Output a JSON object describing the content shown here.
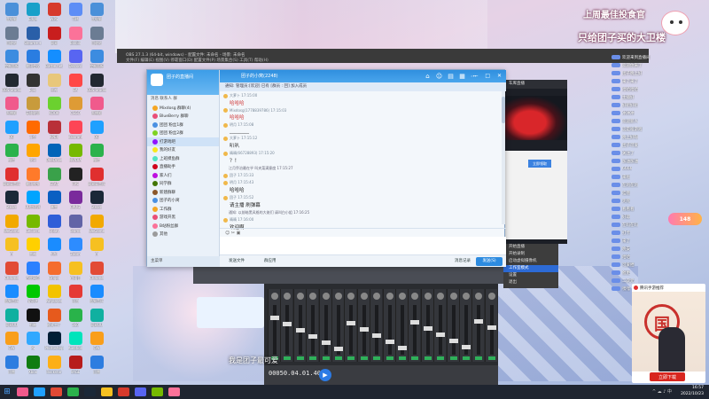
{
  "desktop": {
    "icons_col1": [
      {
        "label": "此电脑",
        "color": "#4a90d9"
      },
      {
        "label": "回收站",
        "color": "#6b7c93"
      },
      {
        "label": "控制面板",
        "color": "#3c8ce0"
      },
      {
        "label": "OBS Studio",
        "color": "#222831"
      },
      {
        "label": "直播姬",
        "color": "#f05a8c"
      },
      {
        "label": "QQ",
        "color": "#1fa0ff"
      },
      {
        "label": "微信",
        "color": "#2bb24c"
      },
      {
        "label": "网易云音乐",
        "color": "#e02f2f"
      },
      {
        "label": "Steam",
        "color": "#1b2838"
      },
      {
        "label": "WeGame",
        "color": "#f2a900"
      },
      {
        "label": "YY",
        "color": "#f6c021"
      },
      {
        "label": "Chrome",
        "color": "#e24a35"
      },
      {
        "label": "酷狗音乐",
        "color": "#1a8cff"
      },
      {
        "label": "网易UU",
        "color": "#10b0a0"
      },
      {
        "label": "OW",
        "color": "#f99e1a"
      },
      {
        "label": "迅雷",
        "color": "#2d7de0"
      }
    ],
    "icons_col2": [
      {
        "label": "Edge",
        "color": "#18a0c9"
      },
      {
        "label": "Steam++",
        "color": "#2a5fa8"
      },
      {
        "label": "腾讯会议",
        "color": "#2a7de1"
      },
      {
        "label": "Epic",
        "color": "#333"
      },
      {
        "label": "英雄联盟",
        "color": "#c89b3c"
      },
      {
        "label": "斗鱼",
        "color": "#ff6a00"
      },
      {
        "label": "虎牙",
        "color": "#ffa500"
      },
      {
        "label": "腾讯视频",
        "color": "#ff7a2a"
      },
      {
        "label": "UU加速器",
        "color": "#00a4ff"
      },
      {
        "label": "GeForce",
        "color": "#76b900"
      },
      {
        "label": "雷神",
        "color": "#ffd000"
      },
      {
        "label": "百度网盘",
        "color": "#2a80ff"
      },
      {
        "label": "爱奇艺",
        "color": "#00c800"
      },
      {
        "label": "剪映",
        "color": "#111"
      },
      {
        "label": "PS",
        "color": "#31a8ff"
      },
      {
        "label": "Xbox",
        "color": "#107c10"
      }
    ],
    "icons_col3": [
      {
        "label": "WPS",
        "color": "#d63a2c"
      },
      {
        "label": "网易",
        "color": "#c81e1e"
      },
      {
        "label": "Battle.net",
        "color": "#148eff"
      },
      {
        "label": "原神",
        "color": "#e8c77a"
      },
      {
        "label": "KOOK",
        "color": "#6bd12f"
      },
      {
        "label": "APEX",
        "color": "#b93038"
      },
      {
        "label": "OneDrive",
        "color": "#0364b8"
      },
      {
        "label": "GTA5",
        "color": "#3aa14a"
      },
      {
        "label": "暴雪",
        "color": "#0a5fc2"
      },
      {
        "label": "Uplay",
        "color": "#2f5ed8"
      },
      {
        "label": "钉钉",
        "color": "#1a8cff"
      },
      {
        "label": "Origin",
        "color": "#f56c2d"
      },
      {
        "label": "Potplayer",
        "color": "#f3c300"
      },
      {
        "label": "格式工厂",
        "color": "#e65a1d"
      },
      {
        "label": "Photoshop",
        "color": "#001e36"
      },
      {
        "label": "Rockstar",
        "color": "#fcaf17"
      }
    ],
    "icons_col4": [
      {
        "label": "TIM",
        "color": "#5c8df6"
      },
      {
        "label": "Bilibili",
        "color": "#fb7299"
      },
      {
        "label": "Discord",
        "color": "#5865f2"
      },
      {
        "label": "EA",
        "color": "#ff4747"
      },
      {
        "label": "CSGO",
        "color": "#de9b35"
      },
      {
        "label": "Valorant",
        "color": "#fd4556"
      },
      {
        "label": "NVIDIA",
        "color": "#76b900"
      },
      {
        "label": "FPS",
        "color": "#222"
      },
      {
        "label": "CPU-Z",
        "color": "#7a2a9c"
      },
      {
        "label": "Teams",
        "color": "#6264a7"
      },
      {
        "label": "Zoom",
        "color": "#2d8cff"
      },
      {
        "label": "YY语音",
        "color": "#f6c021"
      },
      {
        "label": "迅游",
        "color": "#e53935"
      },
      {
        "label": "360",
        "color": "#29b34a"
      },
      {
        "label": "Audition",
        "color": "#00e4bb"
      },
      {
        "label": "RAGE",
        "color": "#b71c1c"
      }
    ]
  },
  "banner": {
    "line1": "上周最佳投食官",
    "line2": "只给团子买的大卫楼"
  },
  "danmaku": [
    "欢迎来到直播间",
    "欢迎你来了",
    "团子晚上好",
    "来了来了",
    "哈哈哈哈",
    "主播好",
    "好听好听",
    "冲冲冲",
    "欢迎新人",
    "这是啥游戏",
    "晚上好呀",
    "团子可爱",
    "关注了",
    "加油加油",
    "6666",
    "来啦",
    "在的在的",
    "哇哦",
    "笑死",
    "看看看",
    "好耶",
    "在吗在吗",
    "打卡",
    "来了",
    "晚安",
    "哈哈",
    "可爱捏",
    "催更",
    "二次元",
    "嘿嘿"
  ],
  "gift": {
    "amount": "148"
  },
  "promo": {
    "header": "腾讯手游推荐",
    "seal": "国",
    "cta": "立即下载"
  },
  "editor": {
    "title": "OBS 27.1.3 (64-bit, windows) - 配置文件: 未命名 - 场景: 未命名",
    "menu": "文件(F)  编辑(E)  视图(V)  停靠窗口(D)  配置文件(P)  场景集合(S)  工具(T)  帮助(H)"
  },
  "preview": {
    "title": "车库直播",
    "button": "立即领取"
  },
  "context_menu": [
    "开始直播",
    "开始录制",
    "启动虚拟摄像机",
    "工作室模式",
    "设置",
    "退出"
  ],
  "mixer": {
    "timecode": "00050.04.01.40",
    "subtitle": "我是团子最可爱"
  },
  "qq": {
    "left": {
      "name": "团子的直播间",
      "toolbar": "消息  联系人  群",
      "groups": [
        {
          "name": "Mixdosg 群聊(4)",
          "color": "#f5a623"
        },
        {
          "name": "BlueBerry 群聊",
          "color": "#e94e77"
        },
        {
          "name": "团团 粉丝1群",
          "color": "#4a90e2"
        },
        {
          "name": "团团 粉丝2群",
          "color": "#7ed321"
        },
        {
          "name": "打游戏吧",
          "color": "#9013fe"
        },
        {
          "name": "我的好友",
          "color": "#f8e71c"
        },
        {
          "name": "上班摸鱼群",
          "color": "#50e3c2"
        },
        {
          "name": "直播助手",
          "color": "#d0021b"
        },
        {
          "name": "家人们",
          "color": "#bd10e0"
        },
        {
          "name": "同学群",
          "color": "#417505"
        },
        {
          "name": "新建群聊",
          "color": "#8b572a"
        },
        {
          "name": "团子的小窝",
          "color": "#4a90e2"
        },
        {
          "name": "工作群",
          "color": "#f5a623"
        },
        {
          "name": "游戏开黑",
          "color": "#e94e77"
        },
        {
          "name": "B站粉丝群",
          "color": "#fb7299"
        },
        {
          "name": "其他",
          "color": "#9b9b9b"
        }
      ],
      "selected_index": 4,
      "footer": "主菜单"
    },
    "title": "团子的小窝(2248)",
    "subtitle": "通知: 管理员:[欢迎] 已有 [群员 : 回] 加入成员",
    "messages": [
      {
        "who": "大萝卜 17:15:00",
        "text": "哈哈哈",
        "red": true
      },
      {
        "who": "Mixdosg(1778839786) 17:15:03",
        "text": "哈哈哈",
        "red": true
      },
      {
        "who": "明月 17:15:08",
        "text": "________",
        "red": false
      },
      {
        "who": "大萝卜 17:15:12",
        "text": "叭叭",
        "red": false
      },
      {
        "who": "晴晴(66728893) 17:15:20",
        "text": "？！",
        "red": false
      },
      {
        "who": "团子 17:15:33",
        "text": "",
        "red": false
      },
      {
        "who": "明月 17:15:43",
        "text": "哈哈哈",
        "red": false
      },
      {
        "who": "团子 17:15:52",
        "text": "请主播 刷弹幕",
        "red": false
      },
      {
        "who": "晴晴 17:16:00",
        "text": "欢迎啊...",
        "red": false
      }
    ],
    "system_line_1": "江月乔治最在乎 叫夹菜满意度 17:15:27",
    "system_line_2": "通知: 以前暗黑风格的大佬们 请叫白小姐 17:16:25",
    "input_tools": "☺ ✂ ▣",
    "bottom_1": "发送文件",
    "bottom_2": "群应用",
    "bottom_3": "消息记录",
    "send": "发送(S)"
  },
  "taskbar": {
    "time": "16:57",
    "date": "2022/10/23",
    "tray": "^ ☁ ♪ 中"
  },
  "taskbar_apps": [
    "#f05a8c",
    "#1fa0ff",
    "#e24a35",
    "#2bb24c",
    "#1b2838",
    "#f6c021",
    "#d63a2c",
    "#5865f2",
    "#76b900",
    "#fb7299"
  ]
}
